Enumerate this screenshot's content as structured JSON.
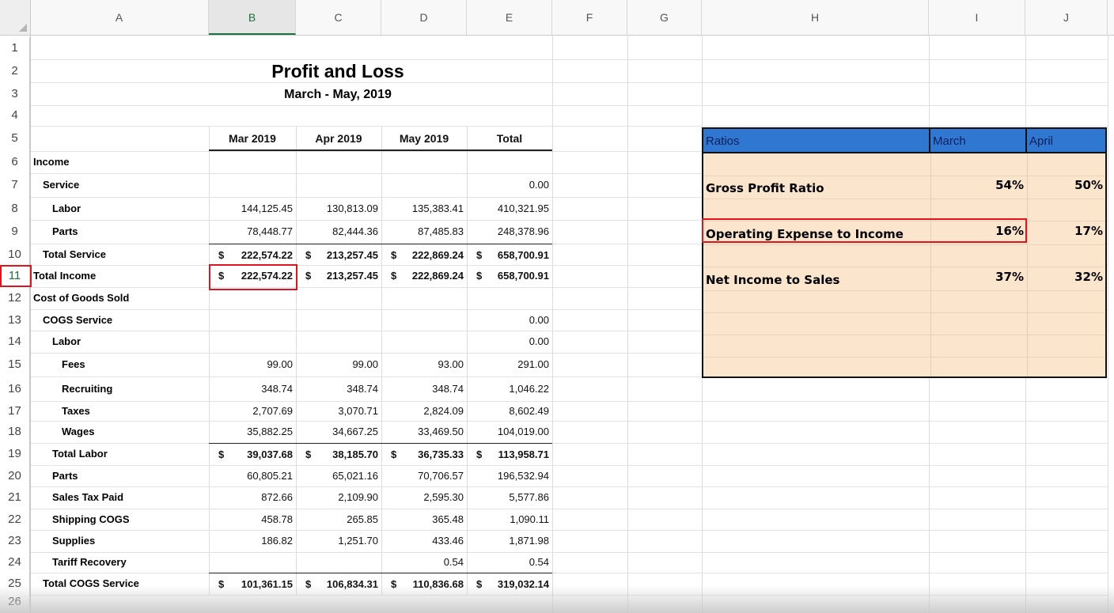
{
  "columns": [
    "A",
    "B",
    "C",
    "D",
    "E",
    "F",
    "G",
    "H",
    "I",
    "J"
  ],
  "selected_column": "B",
  "rows": [
    "1",
    "2",
    "3",
    "4",
    "5",
    "6",
    "7",
    "8",
    "9",
    "10",
    "11",
    "12",
    "13",
    "14",
    "15",
    "16",
    "17",
    "18",
    "19",
    "20",
    "21",
    "22",
    "23",
    "24",
    "25",
    "26"
  ],
  "report": {
    "title": "Profit and Loss",
    "subtitle": "March - May, 2019",
    "headers": [
      "Mar 2019",
      "Apr 2019",
      "May 2019",
      "Total"
    ],
    "lines": [
      {
        "row": 6,
        "label": "Income",
        "indent": 0,
        "values": [
          "",
          "",
          "",
          ""
        ]
      },
      {
        "row": 7,
        "label": "Service",
        "indent": 1,
        "values": [
          "",
          "",
          "",
          "0.00"
        ]
      },
      {
        "row": 8,
        "label": "Labor",
        "indent": 2,
        "values": [
          "144,125.45",
          "130,813.09",
          "135,383.41",
          "410,321.95"
        ]
      },
      {
        "row": 9,
        "label": "Parts",
        "indent": 2,
        "values": [
          "78,448.77",
          "82,444.36",
          "87,485.83",
          "248,378.96"
        ]
      },
      {
        "row": 10,
        "label": "Total Service",
        "indent": 1,
        "total": true,
        "values": [
          "222,574.22",
          "213,257.45",
          "222,869.24",
          "658,700.91"
        ]
      },
      {
        "row": 11,
        "label": "Total Income",
        "indent": 0,
        "total": true,
        "values": [
          "222,574.22",
          "213,257.45",
          "222,869.24",
          "658,700.91"
        ]
      },
      {
        "row": 12,
        "label": "Cost of Goods Sold",
        "indent": 0,
        "values": [
          "",
          "",
          "",
          ""
        ]
      },
      {
        "row": 13,
        "label": "COGS Service",
        "indent": 1,
        "values": [
          "",
          "",
          "",
          "0.00"
        ]
      },
      {
        "row": 14,
        "label": "Labor",
        "indent": 2,
        "values": [
          "",
          "",
          "",
          "0.00"
        ]
      },
      {
        "row": 15,
        "label": "Fees",
        "indent": 3,
        "values": [
          "99.00",
          "99.00",
          "93.00",
          "291.00"
        ]
      },
      {
        "row": 16,
        "label": "Recruiting",
        "indent": 3,
        "values": [
          "348.74",
          "348.74",
          "348.74",
          "1,046.22"
        ]
      },
      {
        "row": 17,
        "label": "Taxes",
        "indent": 3,
        "values": [
          "2,707.69",
          "3,070.71",
          "2,824.09",
          "8,602.49"
        ]
      },
      {
        "row": 18,
        "label": "Wages",
        "indent": 3,
        "values": [
          "35,882.25",
          "34,667.25",
          "33,469.50",
          "104,019.00"
        ]
      },
      {
        "row": 19,
        "label": "Total Labor",
        "indent": 2,
        "total": true,
        "values": [
          "39,037.68",
          "38,185.70",
          "36,735.33",
          "113,958.71"
        ]
      },
      {
        "row": 20,
        "label": "Parts",
        "indent": 2,
        "values": [
          "60,805.21",
          "65,021.16",
          "70,706.57",
          "196,532.94"
        ]
      },
      {
        "row": 21,
        "label": "Sales Tax Paid",
        "indent": 2,
        "values": [
          "872.66",
          "2,109.90",
          "2,595.30",
          "5,577.86"
        ]
      },
      {
        "row": 22,
        "label": "Shipping COGS",
        "indent": 2,
        "values": [
          "458.78",
          "265.85",
          "365.48",
          "1,090.11"
        ]
      },
      {
        "row": 23,
        "label": "Supplies",
        "indent": 2,
        "values": [
          "186.82",
          "1,251.70",
          "433.46",
          "1,871.98"
        ]
      },
      {
        "row": 24,
        "label": "Tariff Recovery",
        "indent": 2,
        "values": [
          "",
          "",
          "0.54",
          "0.54"
        ]
      },
      {
        "row": 25,
        "label": "Total COGS Service",
        "indent": 1,
        "total": true,
        "values": [
          "101,361.15",
          "106,834.31",
          "110,836.68",
          "319,032.14"
        ]
      }
    ],
    "currency_symbol": "$"
  },
  "ratios": {
    "header": {
      "label": "Ratios",
      "march": "March",
      "april": "April"
    },
    "items": [
      {
        "label": "Gross Profit Ratio",
        "march": "54%",
        "april": "50%"
      },
      {
        "label": "Operating Expense to Income",
        "march": "16%",
        "april": "17%"
      },
      {
        "label": "Net Income to Sales",
        "march": "37%",
        "april": "32%"
      }
    ],
    "colors": {
      "header_bg": "#2f77d0",
      "panel_bg": "#fce5cd",
      "highlight": "#e0141e"
    }
  }
}
